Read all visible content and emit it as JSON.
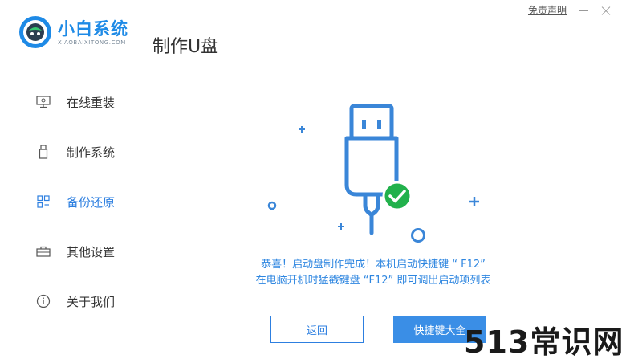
{
  "app": {
    "logo_name": "小白系统",
    "logo_sub": "XIAOBAIXITONG.COM",
    "page_title": "制作U盘"
  },
  "topbar": {
    "disclaimer": "免责声明"
  },
  "sidebar": {
    "items": [
      {
        "label": "在线重装",
        "icon": "monitor-icon"
      },
      {
        "label": "制作系统",
        "icon": "usb-icon"
      },
      {
        "label": "备份还原",
        "icon": "grid-icon",
        "active": true
      },
      {
        "label": "其他设置",
        "icon": "toolbox-icon"
      },
      {
        "label": "关于我们",
        "icon": "info-icon"
      }
    ]
  },
  "main": {
    "message_line1": "恭喜！启动盘制作完成！本机启动快捷键 “ F12”",
    "message_line2": "在电脑开机时猛戳键盘 “F12” 即可调出启动项列表",
    "back_button": "返回",
    "hotkey_button": "快捷键大全"
  },
  "watermark": "513常识网",
  "colors": {
    "accent": "#2d7fe0",
    "success": "#22b14c"
  }
}
